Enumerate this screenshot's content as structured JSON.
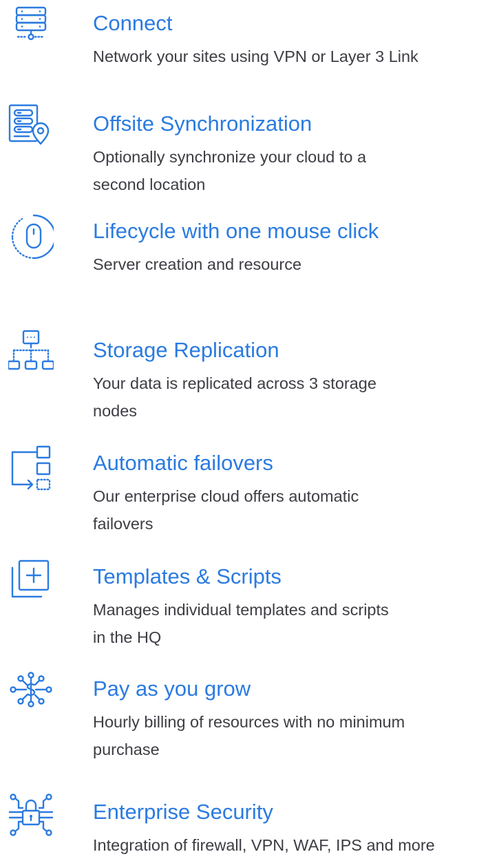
{
  "accent_color": "#2b7be0",
  "text_color": "#3d3d44",
  "features": [
    {
      "icon": "server-stack-icon",
      "title": "Connect",
      "desc_lines": [
        "Network your sites using VPN or Layer 3 Link"
      ]
    },
    {
      "icon": "server-location-icon",
      "title": "Offsite Synchronization",
      "desc_lines": [
        "Optionally synchronize your cloud to a",
        "second location"
      ]
    },
    {
      "icon": "mouse-click-icon",
      "title": "Lifecycle with one mouse click",
      "desc_lines": [
        "Server creation and resource"
      ]
    },
    {
      "icon": "replication-tree-icon",
      "title": "Storage Replication",
      "desc_lines": [
        "Your data is replicated across 3 storage",
        "nodes"
      ]
    },
    {
      "icon": "failover-icon",
      "title": "Automatic failovers",
      "desc_lines": [
        "Our enterprise cloud offers automatic",
        "failovers"
      ]
    },
    {
      "icon": "add-template-icon",
      "title": "Templates & Scripts",
      "desc_lines": [
        "Manages individual templates and scripts",
        "in the HQ"
      ]
    },
    {
      "icon": "dollar-network-icon",
      "title": "Pay as you grow",
      "desc_lines": [
        "Hourly billing of resources with no minimum",
        "purchase"
      ]
    },
    {
      "icon": "lock-circuit-icon",
      "title": "Enterprise Security",
      "desc_lines": [
        "Integration of firewall, VPN, WAF, IPS and more"
      ]
    }
  ]
}
